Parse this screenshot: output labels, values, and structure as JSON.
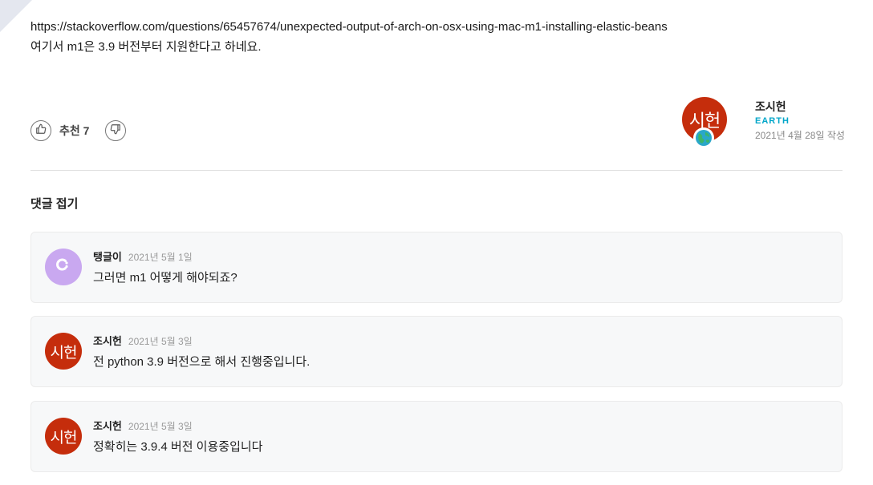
{
  "post": {
    "link": "https://stackoverflow.com/questions/65457674/unexpected-output-of-arch-on-osx-using-mac-m1-installing-elastic-beans",
    "text": "여기서 m1은 3.9 버전부터 지원한다고 하네요."
  },
  "reactions": {
    "upvote_label": "추천 7",
    "upvote_icon": "thumbs-up-icon",
    "downvote_icon": "thumbs-down-icon"
  },
  "author": {
    "avatar_text": "시헌",
    "name": "조시헌",
    "level": "EARTH",
    "date": "2021년 4월 28일 작성",
    "badge_icon": "earth-icon",
    "avatar_color": "#c52d0c",
    "level_color": "#00a6c9"
  },
  "comments_toggle": "댓글 접기",
  "comments": [
    {
      "name": "탱글이",
      "date": "2021년 5월 1일",
      "text": "그러면 m1 어떻게 해야되죠?",
      "avatar_icon": "user-logo-icon",
      "avatar_color": "#c9a8f0"
    },
    {
      "name": "조시헌",
      "date": "2021년 5월 3일",
      "text": "전 python 3.9 버전으로 해서 진행중입니다.",
      "avatar_text": "시헌",
      "avatar_color": "#c52d0c"
    },
    {
      "name": "조시헌",
      "date": "2021년 5월 3일",
      "text": "정확히는 3.9.4 버전 이용중입니다",
      "avatar_text": "시헌",
      "avatar_color": "#c52d0c"
    }
  ]
}
